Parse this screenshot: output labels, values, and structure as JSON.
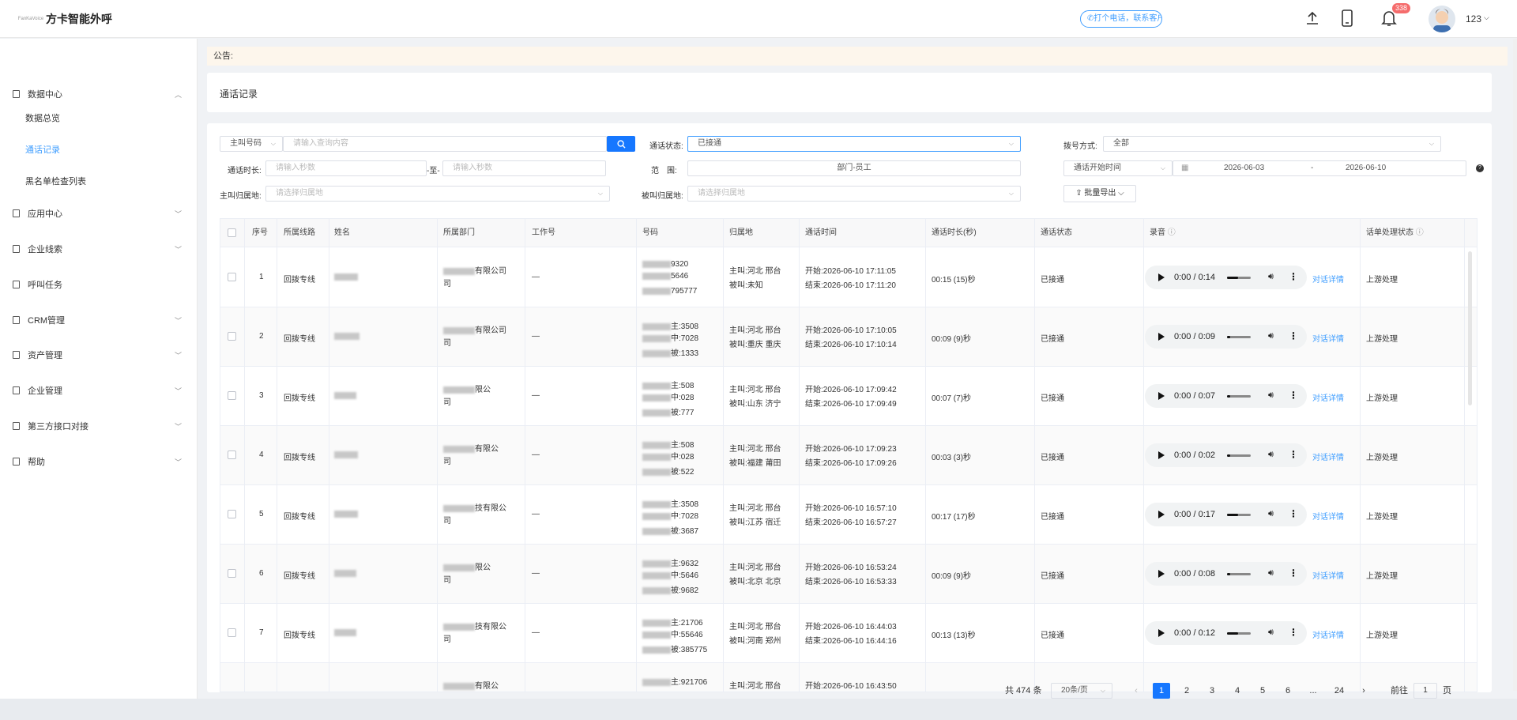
{
  "header": {
    "logo_mark": "FanKaVoice",
    "app_title": "方卡智能外呼",
    "promo": "打个电话，联系客户",
    "notification_count": "338",
    "username": "123"
  },
  "sidebar": {
    "data_center": "数据中心",
    "sub_items": [
      "数据总览",
      "通话记录",
      "黑名单检查列表"
    ],
    "items": [
      "应用中心",
      "企业线索",
      "呼叫任务",
      "CRM管理",
      "资产管理",
      "企业管理",
      "第三方接口对接",
      "帮助"
    ]
  },
  "notice": {
    "label": "公告:"
  },
  "page": {
    "title": "通话记录"
  },
  "filters": {
    "caller_select": "主叫号码",
    "search_placeholder": "请输入查询内容",
    "status_label": "通话状态:",
    "status_value": "已接通",
    "dial_label": "拨号方式:",
    "dial_value": "全部",
    "duration_label": "通话时长:",
    "duration_placeholder": "请输入秒数",
    "duration_sep": "-至-",
    "scope_label": "范　围:",
    "scope_value": "部门-员工",
    "time_select": "通话开始时间",
    "date_start": "2026-06-03",
    "date_sep": "-",
    "date_end": "2026-06-10",
    "caller_region_label": "主叫归属地:",
    "region_placeholder": "请选择归属地",
    "callee_region_label": "被叫归属地:",
    "export_button": "批量导出"
  },
  "table": {
    "headers": [
      "序号",
      "所属线路",
      "姓名",
      "所属部门",
      "工作号",
      "号码",
      "归属地",
      "通话时间",
      "通话时长(秒)",
      "通话状态",
      "录音",
      "话单处理状态"
    ],
    "rows": [
      {
        "no": "1",
        "line": "回拨专线",
        "dept": "有限公司",
        "dept2": "司",
        "work_no": "—",
        "num1": "9320",
        "num2": "5646",
        "num3": "795777",
        "loc1": "主叫:河北 邢台",
        "loc2": "被叫:未知",
        "start": "开始:2026-06-10 17:11:05",
        "end": "结束:2026-06-10 17:11:20",
        "duration": "00:15 (15)秒",
        "status": "已接通",
        "audio_time": "0:00 / 0:14",
        "detail": "对话详情",
        "handle": "上游处理"
      },
      {
        "no": "2",
        "line": "回拨专线",
        "dept": "有限公司",
        "dept2": "司",
        "work_no": "—",
        "num1": "主:3508",
        "num2": "中:7028",
        "num3": "被:1333",
        "loc1": "主叫:河北 邢台",
        "loc2": "被叫:重庆 重庆",
        "start": "开始:2026-06-10 17:10:05",
        "end": "结束:2026-06-10 17:10:14",
        "duration": "00:09 (9)秒",
        "status": "已接通",
        "audio_time": "0:00 / 0:09",
        "detail": "对话详情",
        "handle": "上游处理"
      },
      {
        "no": "3",
        "line": "回拨专线",
        "dept": "限公",
        "dept2": "司",
        "work_no": "—",
        "num1": "主:508",
        "num2": "中:028",
        "num3": "被:777",
        "loc1": "主叫:河北 邢台",
        "loc2": "被叫:山东 济宁",
        "start": "开始:2026-06-10 17:09:42",
        "end": "结束:2026-06-10 17:09:49",
        "duration": "00:07 (7)秒",
        "status": "已接通",
        "audio_time": "0:00 / 0:07",
        "detail": "对话详情",
        "handle": "上游处理"
      },
      {
        "no": "4",
        "line": "回拨专线",
        "dept": "有限公",
        "dept2": "司",
        "work_no": "—",
        "num1": "主:508",
        "num2": "中:028",
        "num3": "被:522",
        "loc1": "主叫:河北 邢台",
        "loc2": "被叫:福建 莆田",
        "start": "开始:2026-06-10 17:09:23",
        "end": "结束:2026-06-10 17:09:26",
        "duration": "00:03 (3)秒",
        "status": "已接通",
        "audio_time": "0:00 / 0:02",
        "detail": "对话详情",
        "handle": "上游处理"
      },
      {
        "no": "5",
        "line": "回拨专线",
        "dept": "技有限公",
        "dept2": "司",
        "work_no": "—",
        "num1": "主:3508",
        "num2": "中:7028",
        "num3": "被:3687",
        "loc1": "主叫:河北 邢台",
        "loc2": "被叫:江苏 宿迁",
        "start": "开始:2026-06-10 16:57:10",
        "end": "结束:2026-06-10 16:57:27",
        "duration": "00:17 (17)秒",
        "status": "已接通",
        "audio_time": "0:00 / 0:17",
        "detail": "对话详情",
        "handle": "上游处理"
      },
      {
        "no": "6",
        "line": "回拨专线",
        "dept": "限公",
        "dept2": "司",
        "work_no": "—",
        "num1": "主:9632",
        "num2": "中:5646",
        "num3": "被:9682",
        "loc1": "主叫:河北 邢台",
        "loc2": "被叫:北京 北京",
        "start": "开始:2026-06-10 16:53:24",
        "end": "结束:2026-06-10 16:53:33",
        "duration": "00:09 (9)秒",
        "status": "已接通",
        "audio_time": "0:00 / 0:08",
        "detail": "对话详情",
        "handle": "上游处理"
      },
      {
        "no": "7",
        "line": "回拨专线",
        "dept": "技有限公",
        "dept2": "司",
        "work_no": "—",
        "num1": "主:21706",
        "num2": "中:55646",
        "num3": "被:385775",
        "loc1": "主叫:河北 邢台",
        "loc2": "被叫:河南 郑州",
        "start": "开始:2026-06-10 16:44:03",
        "end": "结束:2026-06-10 16:44:16",
        "duration": "00:13 (13)秒",
        "status": "已接通",
        "audio_time": "0:00 / 0:12",
        "detail": "对话详情",
        "handle": "上游处理"
      },
      {
        "no": "",
        "line": "",
        "dept": "有限公",
        "dept2": "",
        "work_no": "",
        "num1": "主:921706",
        "num2": "",
        "num3": "",
        "loc1": "主叫:河北 邢台",
        "loc2": "",
        "start": "开始:2026-06-10 16:43:50",
        "end": "",
        "duration": "",
        "status": "",
        "audio_time": "",
        "detail": "",
        "handle": ""
      }
    ]
  },
  "pagination": {
    "total": "共 474 条",
    "page_size": "20条/页",
    "pages": [
      "1",
      "2",
      "3",
      "4",
      "5",
      "6",
      "...",
      "24"
    ],
    "goto_label": "前往",
    "goto_value": "1",
    "page_suffix": "页"
  },
  "colors": {
    "primary": "#1677ff",
    "link": "#409eff",
    "notice_bg": "#fdf6ec",
    "badge": "#f56c6c"
  }
}
